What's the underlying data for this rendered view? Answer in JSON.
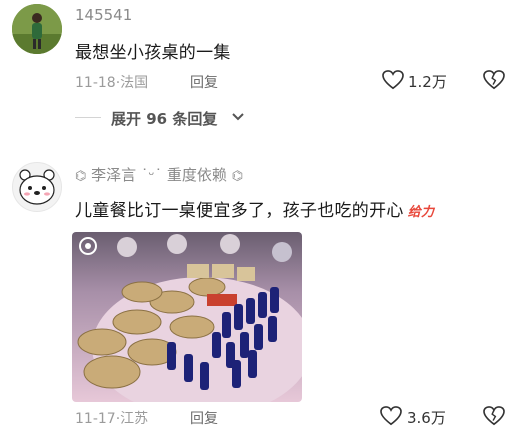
{
  "comments": [
    {
      "username": "145541",
      "content": "最想坐小孩桌的一集",
      "date": "11-18",
      "location": "法国",
      "reply_label": "回复",
      "likes": "1.2万"
    },
    {
      "username": "李泽言",
      "username_suffix": "重度依赖",
      "content": "儿童餐比订一桌便宜多了，孩子也吃的开心",
      "emoji_text": "给力",
      "date": "11-17",
      "location": "江苏",
      "reply_label": "回复",
      "likes": "3.6万"
    }
  ],
  "expand_replies": "展开 96 条回复",
  "icons": [
    "heart-icon",
    "broken-heart-icon",
    "chevron-down-icon",
    "link-icon",
    "bear-avatar"
  ],
  "colors": {
    "accent_gift": "#e8483b",
    "meta": "#9b9b9b"
  }
}
